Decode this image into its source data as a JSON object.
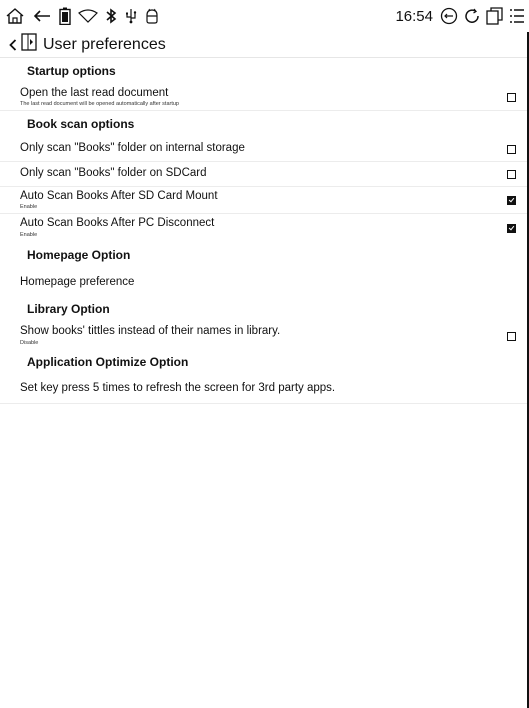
{
  "status": {
    "time": "16:54"
  },
  "titlebar": {
    "title": "User preferences"
  },
  "sections": {
    "startup": {
      "title": "Startup options",
      "open_last": {
        "title": "Open the last read document",
        "subtitle": "The last read document will be opened automatically after startup",
        "checked": false
      }
    },
    "bookscan": {
      "title": "Book scan options",
      "internal": {
        "title": "Only scan \"Books\" folder on internal storage",
        "checked": false
      },
      "sdcard": {
        "title": "Only scan \"Books\" folder on SDCard",
        "checked": false
      },
      "after_sd": {
        "title": "Auto Scan Books After SD Card Mount",
        "subtitle": "Enable",
        "checked": true
      },
      "after_pc": {
        "title": "Auto Scan Books After PC Disconnect",
        "subtitle": "Enable",
        "checked": true
      }
    },
    "homepage": {
      "title": "Homepage Option",
      "preference": {
        "title": "Homepage preference"
      }
    },
    "library": {
      "title": "Library Option",
      "titles": {
        "title": "Show books' tittles instead of their names in library.",
        "subtitle": "Disable",
        "checked": false
      }
    },
    "optimize": {
      "title": "Application Optimize Option",
      "refresh": {
        "title": "Set key press 5 times to refresh the screen for 3rd party apps."
      }
    }
  }
}
